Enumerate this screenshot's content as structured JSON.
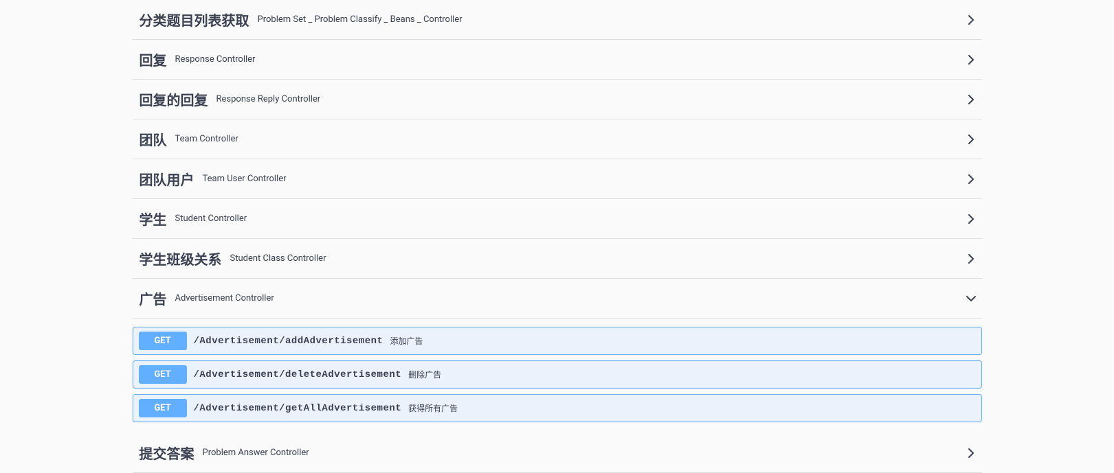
{
  "tags": [
    {
      "title": "分类题目列表获取",
      "desc": "Problem Set _ Problem Classify _ Beans _ Controller",
      "expanded": false,
      "ops": []
    },
    {
      "title": "回复",
      "desc": "Response Controller",
      "expanded": false,
      "ops": []
    },
    {
      "title": "回复的回复",
      "desc": "Response Reply Controller",
      "expanded": false,
      "ops": []
    },
    {
      "title": "团队",
      "desc": "Team Controller",
      "expanded": false,
      "ops": []
    },
    {
      "title": "团队用户",
      "desc": "Team User Controller",
      "expanded": false,
      "ops": []
    },
    {
      "title": "学生",
      "desc": "Student Controller",
      "expanded": false,
      "ops": []
    },
    {
      "title": "学生班级关系",
      "desc": "Student Class Controller",
      "expanded": false,
      "ops": []
    },
    {
      "title": "广告",
      "desc": "Advertisement Controller",
      "expanded": true,
      "ops": [
        {
          "method": "GET",
          "path": "/Advertisement/addAdvertisement",
          "desc": "添加广告"
        },
        {
          "method": "GET",
          "path": "/Advertisement/deleteAdvertisement",
          "desc": "删除广告"
        },
        {
          "method": "GET",
          "path": "/Advertisement/getAllAdvertisement",
          "desc": "获得所有广告"
        }
      ]
    },
    {
      "title": "提交答案",
      "desc": "Problem Answer Controller",
      "expanded": false,
      "ops": []
    }
  ]
}
